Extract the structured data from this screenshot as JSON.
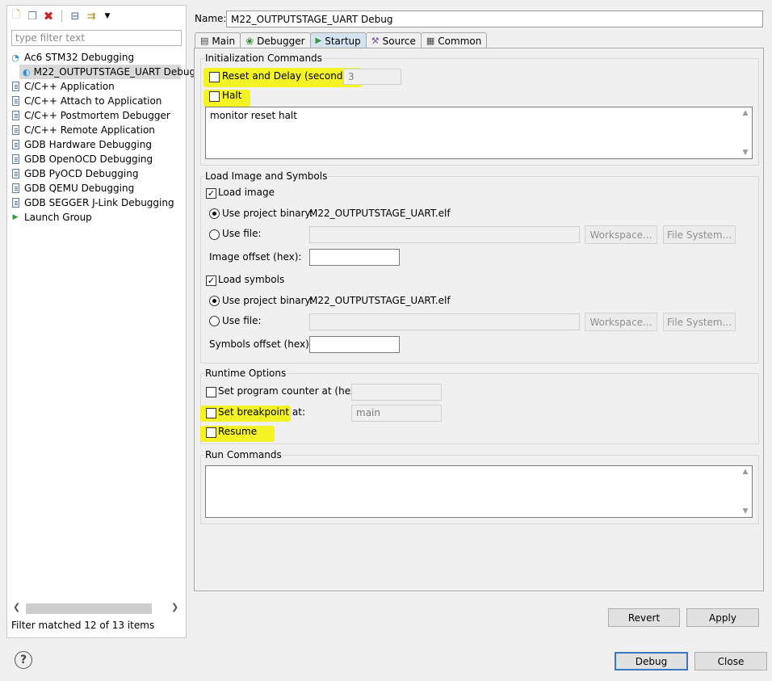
{
  "toolbar": {
    "icons": [
      "new-config-icon",
      "duplicate-icon",
      "delete-icon",
      "collapse-all-icon",
      "filter-icon",
      "dropdown-arrow-icon"
    ]
  },
  "filter": {
    "placeholder": "type filter text",
    "value": ""
  },
  "tree": {
    "items": [
      {
        "label": "Ac6 STM32 Debugging",
        "icon": "debug-group-icon"
      },
      {
        "label": "M22_OUTPUTSTAGE_UART Debug",
        "icon": "debug-config-icon",
        "selected": true
      },
      {
        "label": "C/C++ Application",
        "icon": "doc-icon"
      },
      {
        "label": "C/C++ Attach to Application",
        "icon": "doc-icon"
      },
      {
        "label": "C/C++ Postmortem Debugger",
        "icon": "doc-icon"
      },
      {
        "label": "C/C++ Remote Application",
        "icon": "doc-icon"
      },
      {
        "label": "GDB Hardware Debugging",
        "icon": "doc-icon"
      },
      {
        "label": "GDB OpenOCD Debugging",
        "icon": "doc-icon"
      },
      {
        "label": "GDB PyOCD Debugging",
        "icon": "doc-icon"
      },
      {
        "label": "GDB QEMU Debugging",
        "icon": "doc-icon"
      },
      {
        "label": "GDB SEGGER J-Link Debugging",
        "icon": "doc-icon"
      },
      {
        "label": "Launch Group",
        "icon": "play-icon"
      }
    ],
    "status": "Filter matched 12 of 13 items"
  },
  "name": {
    "label": "Name:",
    "value": "M22_OUTPUTSTAGE_UART Debug"
  },
  "tabs": [
    {
      "label": "Main",
      "icon": "main-tab-icon"
    },
    {
      "label": "Debugger",
      "icon": "debugger-tab-icon"
    },
    {
      "label": "Startup",
      "icon": "startup-tab-icon",
      "active": true
    },
    {
      "label": "Source",
      "icon": "source-tab-icon"
    },
    {
      "label": "Common",
      "icon": "common-tab-icon"
    }
  ],
  "init": {
    "title": "Initialization Commands",
    "reset_label": "Reset and Delay (seconds):",
    "reset_checked": false,
    "delay_value": "3",
    "halt_label": "Halt",
    "halt_checked": false,
    "commands": "monitor reset halt"
  },
  "load": {
    "title": "Load Image and Symbols",
    "load_image_label": "Load image",
    "load_image_checked": true,
    "use_project_binary_label": "Use project binary:",
    "image_binary": "M22_OUTPUTSTAGE_UART.elf",
    "use_file_label": "Use file:",
    "workspace_label": "Workspace...",
    "filesystem_label": "File System...",
    "image_offset_label": "Image offset (hex):",
    "load_symbols_label": "Load symbols",
    "load_symbols_checked": true,
    "symbols_binary": "M22_OUTPUTSTAGE_UART.elf",
    "symbols_offset_label": "Symbols offset (hex):"
  },
  "runtime": {
    "title": "Runtime Options",
    "pc_label": "Set program counter at (hex):",
    "pc_checked": false,
    "breakpoint_label": "Set breakpoint at:",
    "breakpoint_checked": false,
    "breakpoint_value": "main",
    "resume_label": "Resume",
    "resume_checked": false
  },
  "run": {
    "title": "Run Commands",
    "commands": ""
  },
  "buttons": {
    "revert": "Revert",
    "apply": "Apply",
    "debug": "Debug",
    "close": "Close"
  },
  "colors": {
    "highlight": "#f5f500",
    "selection": "#d9d9d9",
    "active_tab": "#d5e3f0"
  }
}
